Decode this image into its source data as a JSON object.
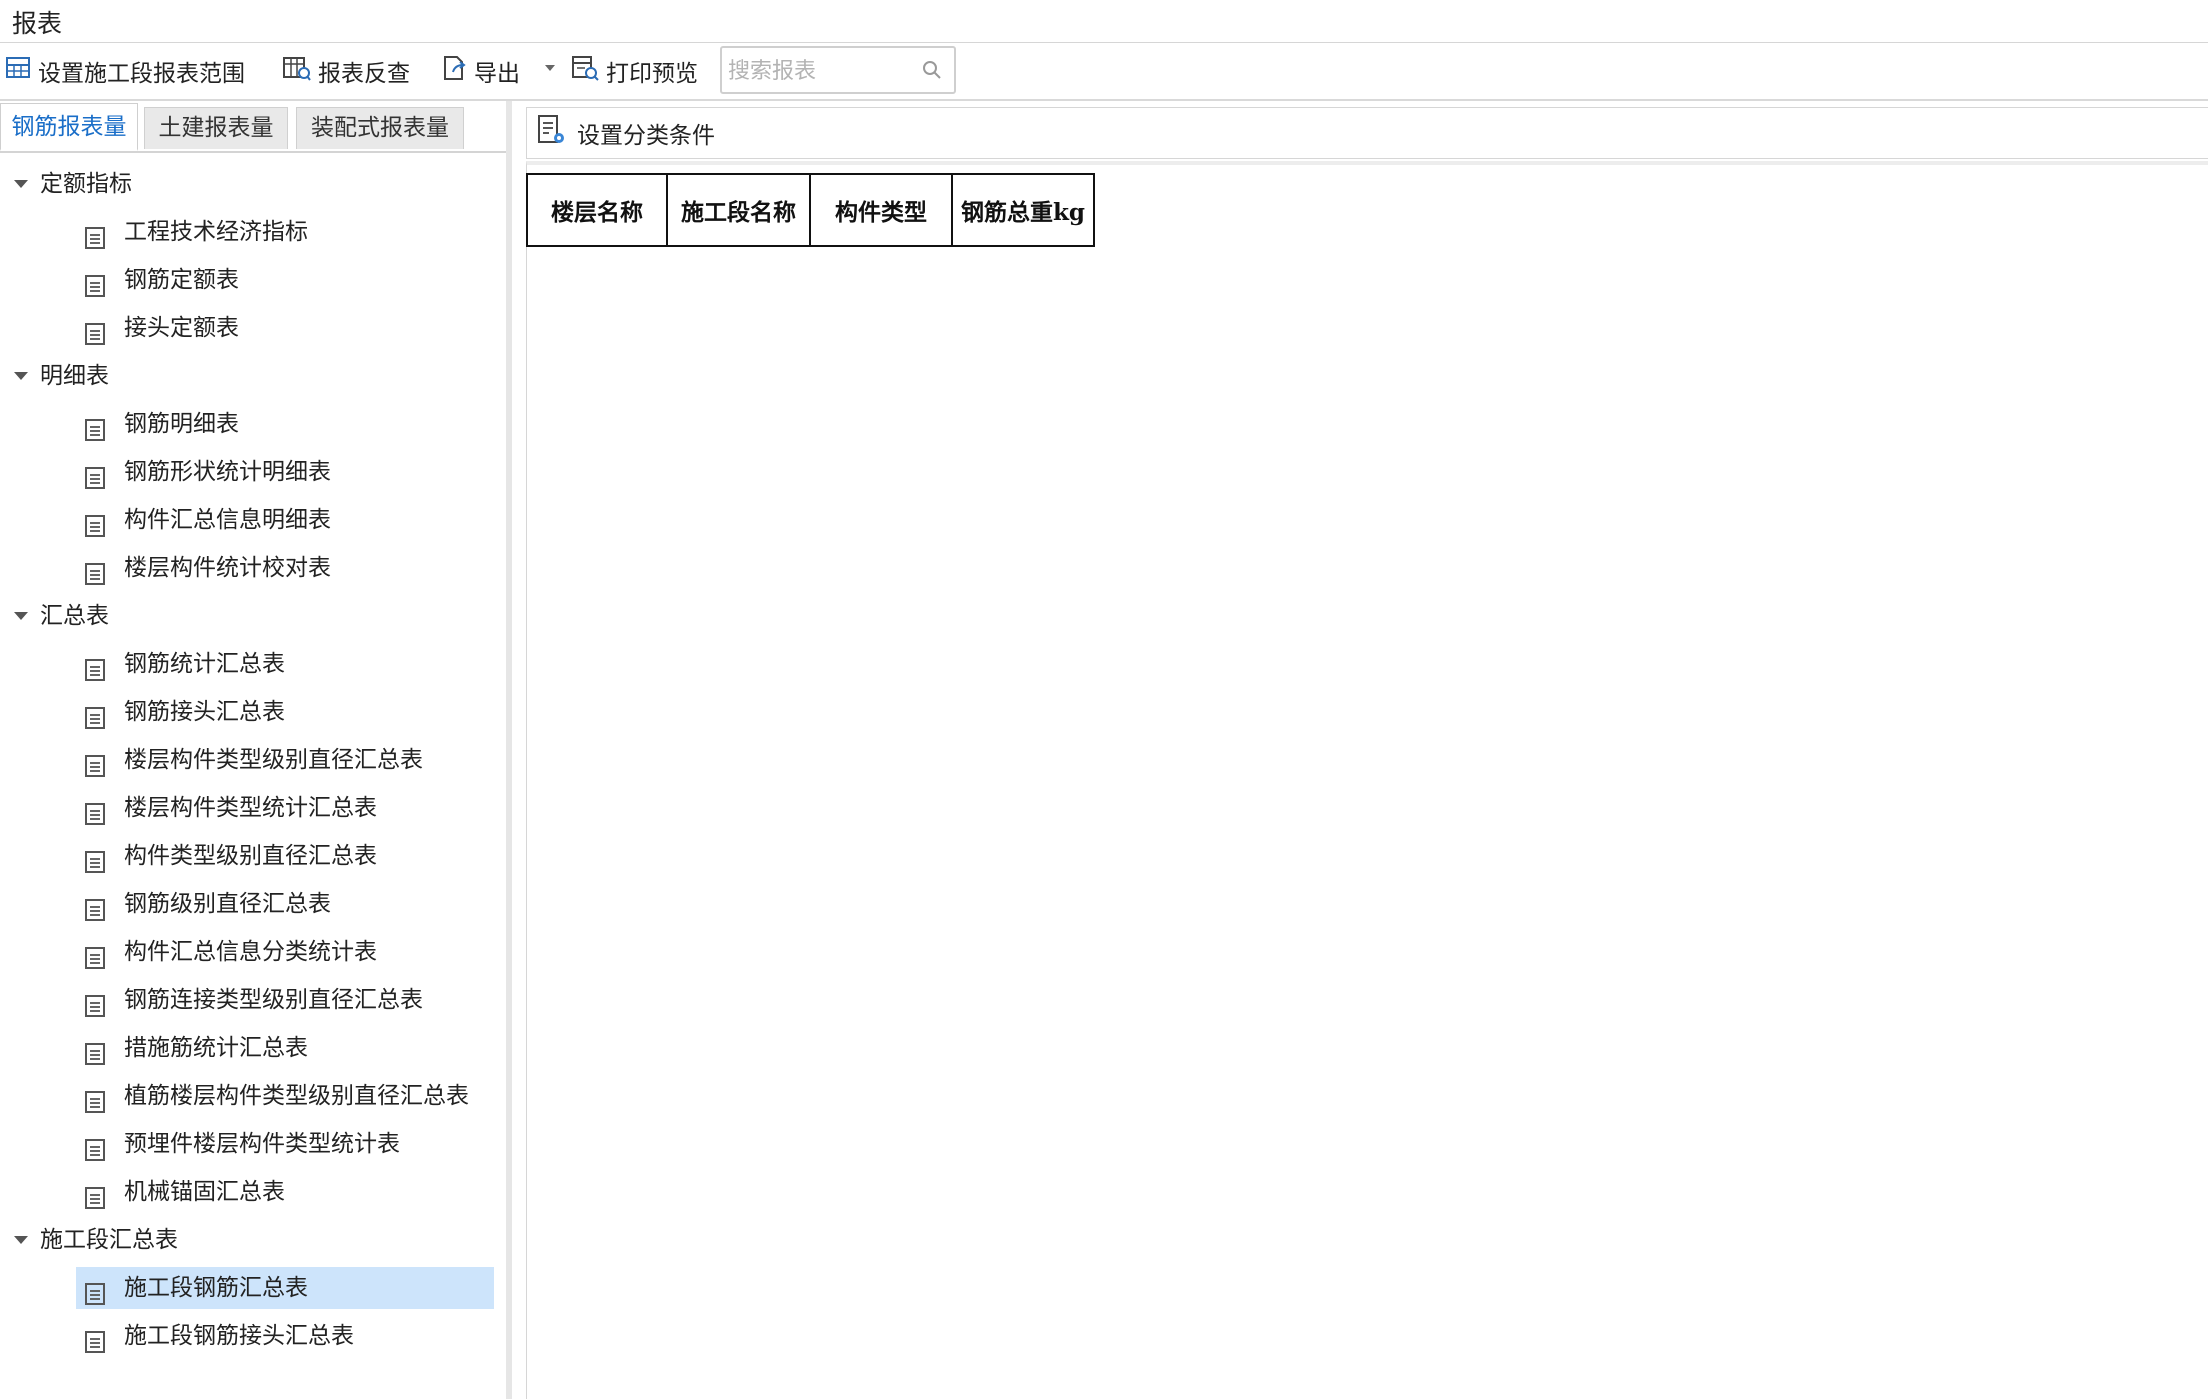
{
  "window": {
    "title": "报表"
  },
  "toolbar": {
    "set_range_label": "设置施工段报表范围",
    "reverse_check_label": "报表反查",
    "export_label": "导出",
    "print_preview_label": "打印预览",
    "search_placeholder": "搜索报表"
  },
  "left_tabs": [
    {
      "label": "钢筋报表量",
      "active": true
    },
    {
      "label": "土建报表量",
      "active": false
    },
    {
      "label": "装配式报表量",
      "active": false
    }
  ],
  "tree": [
    {
      "label": "定额指标",
      "items": [
        "工程技术经济指标",
        "钢筋定额表",
        "接头定额表"
      ]
    },
    {
      "label": "明细表",
      "items": [
        "钢筋明细表",
        "钢筋形状统计明细表",
        "构件汇总信息明细表",
        "楼层构件统计校对表"
      ]
    },
    {
      "label": "汇总表",
      "items": [
        "钢筋统计汇总表",
        "钢筋接头汇总表",
        "楼层构件类型级别直径汇总表",
        "楼层构件类型统计汇总表",
        "构件类型级别直径汇总表",
        "钢筋级别直径汇总表",
        "构件汇总信息分类统计表",
        "钢筋连接类型级别直径汇总表",
        "措施筋统计汇总表",
        "植筋楼层构件类型级别直径汇总表",
        "预埋件楼层构件类型统计表",
        "机械锚固汇总表"
      ]
    },
    {
      "label": "施工段汇总表",
      "items": [
        "施工段钢筋汇总表",
        "施工段钢筋接头汇总表"
      ]
    }
  ],
  "selected_item": "施工段钢筋汇总表",
  "right_toolbar": {
    "set_filter_label": "设置分类条件"
  },
  "report_table": {
    "headers": [
      "楼层名称",
      "施工段名称",
      "构件类型",
      "钢筋总重kg"
    ]
  },
  "colors": {
    "accent": "#1a6ec8",
    "selected_bg": "#cde4fb"
  }
}
